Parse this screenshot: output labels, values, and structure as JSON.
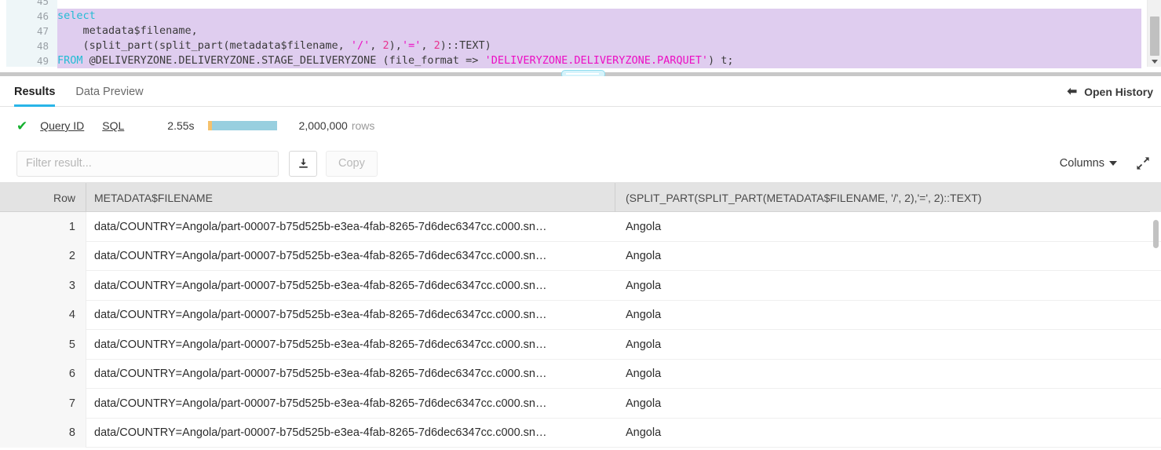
{
  "editor": {
    "lines": [
      {
        "num": "45",
        "selected": false,
        "tokens": []
      },
      {
        "num": "46",
        "selected": true,
        "tokens": [
          {
            "t": "select",
            "c": "kw"
          }
        ]
      },
      {
        "num": "47",
        "selected": true,
        "tokens": [
          {
            "t": "    metadata$filename,",
            "c": "plain"
          }
        ]
      },
      {
        "num": "48",
        "selected": true,
        "tokens": [
          {
            "t": "    (split_part(split_part(metadata$filename, ",
            "c": "plain"
          },
          {
            "t": "'/'",
            "c": "str"
          },
          {
            "t": ", ",
            "c": "plain"
          },
          {
            "t": "2",
            "c": "num"
          },
          {
            "t": "),",
            "c": "plain"
          },
          {
            "t": "'='",
            "c": "str"
          },
          {
            "t": ", ",
            "c": "plain"
          },
          {
            "t": "2",
            "c": "num"
          },
          {
            "t": ")::TEXT)",
            "c": "plain"
          }
        ]
      },
      {
        "num": "49",
        "selected": true,
        "tokens": [
          {
            "t": "FROM",
            "c": "kw"
          },
          {
            "t": " @DELIVERYZONE.DELIVERYZONE.STAGE_DELIVERYZONE (file_format => ",
            "c": "plain"
          },
          {
            "t": "'DELIVERYZONE.DELIVERYZONE.PARQUET'",
            "c": "str"
          },
          {
            "t": ") t;",
            "c": "plain"
          }
        ]
      }
    ]
  },
  "tabs": {
    "results_label": "Results",
    "data_preview_label": "Data Preview",
    "open_history_label": "Open History"
  },
  "status": {
    "check_glyph": "✔",
    "query_id_label": "Query ID",
    "sql_label": "SQL",
    "duration": "2.55s",
    "row_count": "2,000,000",
    "rows_label": "rows"
  },
  "toolbar": {
    "filter_placeholder": "Filter result...",
    "filter_value": "",
    "copy_label": "Copy",
    "columns_label": "Columns"
  },
  "table": {
    "columns": [
      "Row",
      "METADATA$FILENAME",
      "(SPLIT_PART(SPLIT_PART(METADATA$FILENAME, '/', 2),'=', 2)::TEXT)"
    ],
    "rows": [
      {
        "n": "1",
        "filename": "data/COUNTRY=Angola/part-00007-b75d525b-e3ea-4fab-8265-7d6dec6347cc.c000.sn…",
        "country": "Angola"
      },
      {
        "n": "2",
        "filename": "data/COUNTRY=Angola/part-00007-b75d525b-e3ea-4fab-8265-7d6dec6347cc.c000.sn…",
        "country": "Angola"
      },
      {
        "n": "3",
        "filename": "data/COUNTRY=Angola/part-00007-b75d525b-e3ea-4fab-8265-7d6dec6347cc.c000.sn…",
        "country": "Angola"
      },
      {
        "n": "4",
        "filename": "data/COUNTRY=Angola/part-00007-b75d525b-e3ea-4fab-8265-7d6dec6347cc.c000.sn…",
        "country": "Angola"
      },
      {
        "n": "5",
        "filename": "data/COUNTRY=Angola/part-00007-b75d525b-e3ea-4fab-8265-7d6dec6347cc.c000.sn…",
        "country": "Angola"
      },
      {
        "n": "6",
        "filename": "data/COUNTRY=Angola/part-00007-b75d525b-e3ea-4fab-8265-7d6dec6347cc.c000.sn…",
        "country": "Angola"
      },
      {
        "n": "7",
        "filename": "data/COUNTRY=Angola/part-00007-b75d525b-e3ea-4fab-8265-7d6dec6347cc.c000.sn…",
        "country": "Angola"
      },
      {
        "n": "8",
        "filename": "data/COUNTRY=Angola/part-00007-b75d525b-e3ea-4fab-8265-7d6dec6347cc.c000.sn…",
        "country": "Angola"
      }
    ]
  },
  "colors": {
    "accent": "#29b5e8",
    "success": "#14b02e",
    "selection": "#dfcdef",
    "progress_a": "#f5c16c",
    "progress_b": "#98cfdf"
  }
}
